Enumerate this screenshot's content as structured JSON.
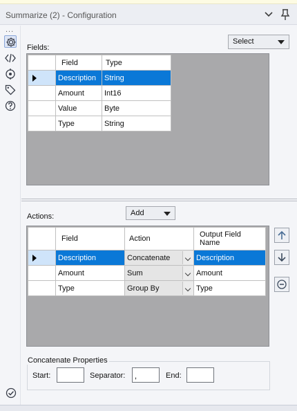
{
  "window": {
    "title": "Summarize (2) - Configuration",
    "chevron_icon": "chevron-down-icon",
    "pin_icon": "pin-icon"
  },
  "toolbar": {
    "overflow_dots": "...",
    "items": [
      "gear-icon",
      "code-icon",
      "target-icon",
      "tag-icon",
      "help-icon"
    ]
  },
  "fields_section": {
    "label": "Fields:",
    "select_button": "Select",
    "columns": [
      "Field",
      "Type"
    ],
    "rows": [
      {
        "field": "Description",
        "type": "String",
        "selected": true
      },
      {
        "field": "Amount",
        "type": "Int16",
        "selected": false
      },
      {
        "field": "Value",
        "type": "Byte",
        "selected": false
      },
      {
        "field": "Type",
        "type": "String",
        "selected": false
      }
    ]
  },
  "actions_section": {
    "label": "Actions:",
    "add_button": "Add",
    "columns": [
      "Field",
      "Action",
      "Output Field Name"
    ],
    "rows": [
      {
        "field": "Description",
        "action": "Concatenate",
        "output": "Description",
        "selected": true
      },
      {
        "field": "Amount",
        "action": "Sum",
        "output": "Amount",
        "selected": false
      },
      {
        "field": "Type",
        "action": "Group By",
        "output": "Type",
        "selected": false
      }
    ],
    "side_buttons": [
      "move-up-icon",
      "move-down-icon",
      "remove-icon"
    ]
  },
  "concatenate": {
    "title": "Concatenate Properties",
    "start_label": "Start:",
    "start_value": "",
    "separator_label": "Separator:",
    "separator_value": ",",
    "end_label": "End:",
    "end_value": ""
  },
  "footer": {
    "status_icon": "check-circle-icon"
  },
  "colors": {
    "selection": "#0a78d7",
    "grid_background": "#a9a9ab",
    "panel": "#f4f5f8"
  }
}
